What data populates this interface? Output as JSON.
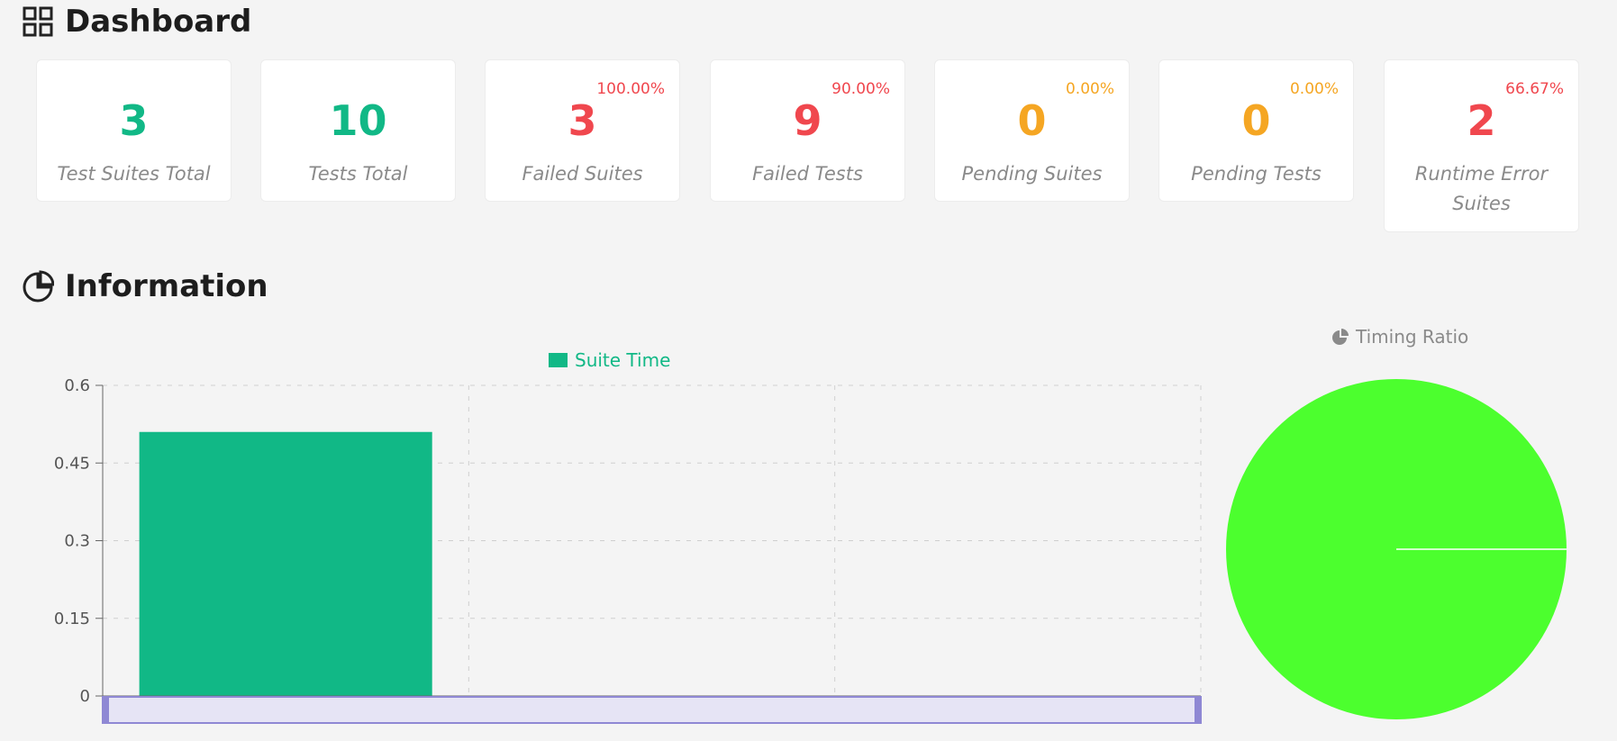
{
  "dashboard": {
    "title": "Dashboard",
    "icon": "grid-icon",
    "cards": [
      {
        "value": "3",
        "label": "Test Suites Total",
        "percent": "",
        "color": "#11b886"
      },
      {
        "value": "10",
        "label": "Tests Total",
        "percent": "",
        "color": "#11b886"
      },
      {
        "value": "3",
        "label": "Failed Suites",
        "percent": "100.00%",
        "color": "#f0474e"
      },
      {
        "value": "9",
        "label": "Failed Tests",
        "percent": "90.00%",
        "color": "#f0474e"
      },
      {
        "value": "0",
        "label": "Pending Suites",
        "percent": "0.00%",
        "color": "#f5a623"
      },
      {
        "value": "0",
        "label": "Pending Tests",
        "percent": "0.00%",
        "color": "#f5a623"
      },
      {
        "value": "2",
        "label": "Runtime Error Suites",
        "percent": "66.67%",
        "color": "#f0474e"
      }
    ]
  },
  "information": {
    "title": "Information",
    "icon": "pie-chart-icon"
  },
  "chart_data": [
    {
      "type": "bar",
      "legend": "Suite Time",
      "legend_position": "top-center",
      "categories": [
        "",
        "",
        ""
      ],
      "series": [
        {
          "name": "Suite Time",
          "values": [
            0.51,
            0,
            0
          ],
          "color": "#11b886"
        }
      ],
      "yticks": [
        "0",
        "0.15",
        "0.3",
        "0.45",
        "0.6"
      ],
      "ylim": [
        0,
        0.6
      ],
      "grid": true,
      "has_data_zoom_slider": true
    },
    {
      "type": "pie",
      "legend": "Timing Ratio",
      "legend_icon": "pie-chart-icon",
      "slices": [
        {
          "name": "",
          "value": 1,
          "color": "#4cff2e"
        }
      ]
    }
  ]
}
